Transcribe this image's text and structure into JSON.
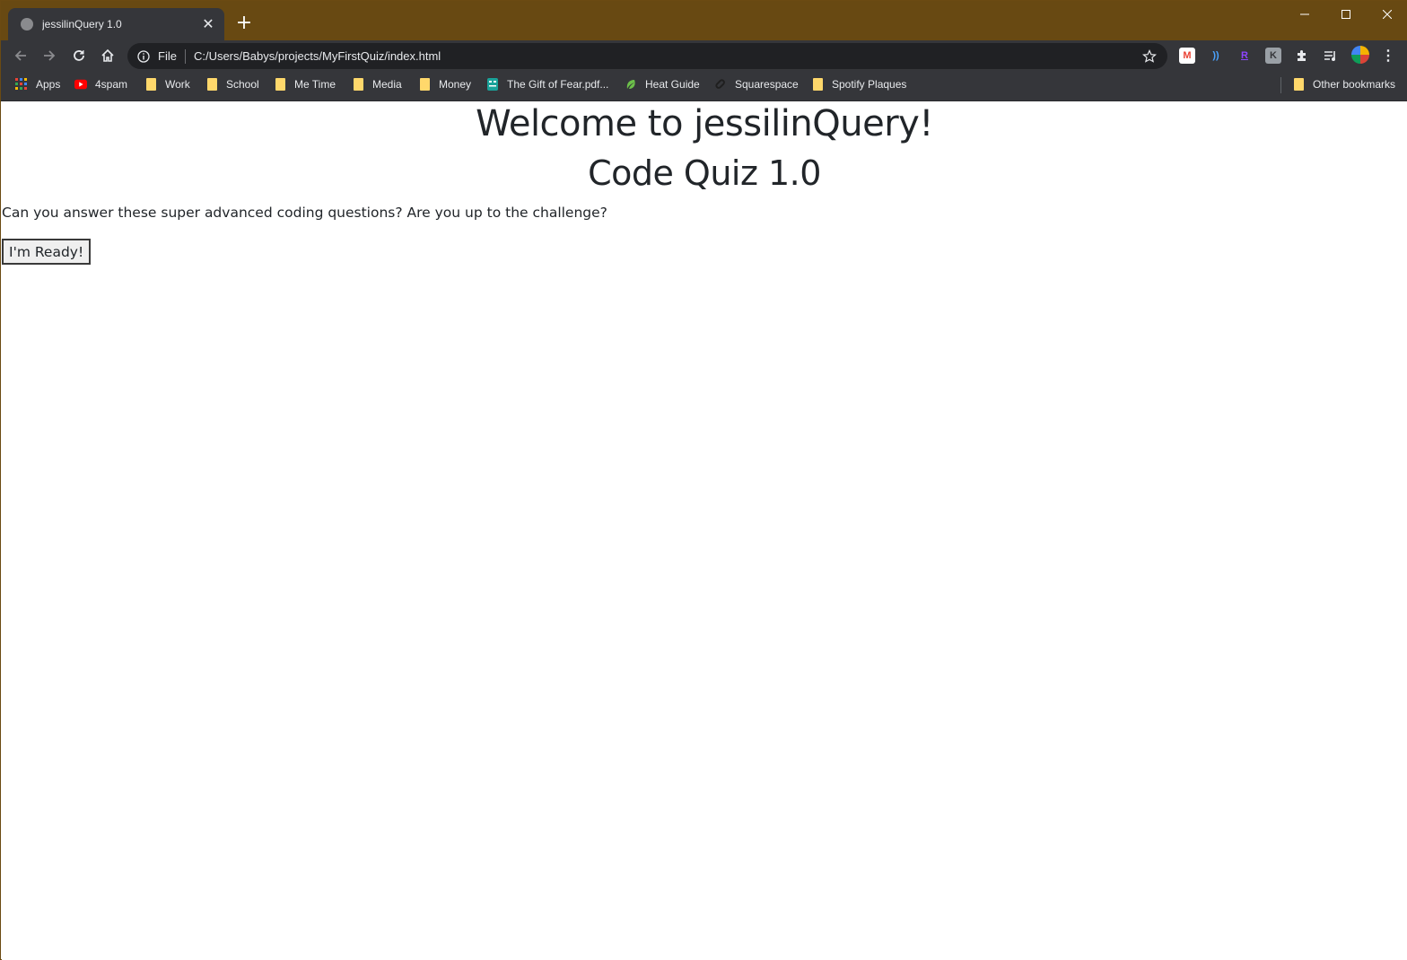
{
  "tab": {
    "title": "jessilinQuery 1.0",
    "close_glyph": "✕",
    "new_tab_glyph": "+"
  },
  "window_controls": [
    "minimize-icon",
    "maximize-icon",
    "close-icon"
  ],
  "omnibox": {
    "chip": "File",
    "url": "C:/Users/Babys/projects/MyFirstQuiz/index.html"
  },
  "extensions": [
    {
      "name": "gmail-extension-icon",
      "glyph": "M",
      "color": "#ea4335"
    },
    {
      "name": "audio-extension-icon",
      "glyph": "))",
      "color": "#4aa3ff"
    },
    {
      "name": "r-extension-icon",
      "glyph": "R",
      "color": "#8e44ff"
    },
    {
      "name": "k-extension-icon",
      "glyph": "K",
      "color": "#9aa0a6"
    },
    {
      "name": "puzzle-extension-icon",
      "glyph": "",
      "color": "#e8eaed"
    },
    {
      "name": "media-queue-icon",
      "glyph": "",
      "color": "#e8eaed"
    },
    {
      "name": "profile-avatar",
      "glyph": "",
      "color": "#f4b400"
    },
    {
      "name": "menu-kebab-icon",
      "glyph": "⋮",
      "color": "#e8eaed"
    }
  ],
  "bookmarks": {
    "items": [
      {
        "label": "Apps",
        "icon": "apps-grid-icon"
      },
      {
        "label": "4spam",
        "icon": "youtube-icon"
      },
      {
        "label": "Work",
        "icon": "folder-icon"
      },
      {
        "label": "School",
        "icon": "folder-icon"
      },
      {
        "label": "Me Time",
        "icon": "folder-icon"
      },
      {
        "label": "Media",
        "icon": "folder-icon"
      },
      {
        "label": "Money",
        "icon": "folder-icon"
      },
      {
        "label": "The Gift of Fear.pdf...",
        "icon": "reader-app-icon"
      },
      {
        "label": "Heat Guide",
        "icon": "heat-leaf-icon"
      },
      {
        "label": "Squarespace",
        "icon": "squarespace-icon"
      },
      {
        "label": "Spotify Plaques",
        "icon": "folder-icon"
      }
    ],
    "other": "Other bookmarks"
  },
  "page": {
    "heading": "Welcome to jessilinQuery!",
    "subheading": "Code Quiz 1.0",
    "intro": "Can you answer these super advanced coding questions? Are you up to the challenge?",
    "start_button": "I'm Ready!"
  },
  "colors": {
    "titlebar": "#684912",
    "toolbar": "#35363a",
    "omnibox": "#202124",
    "text": "#212529"
  }
}
